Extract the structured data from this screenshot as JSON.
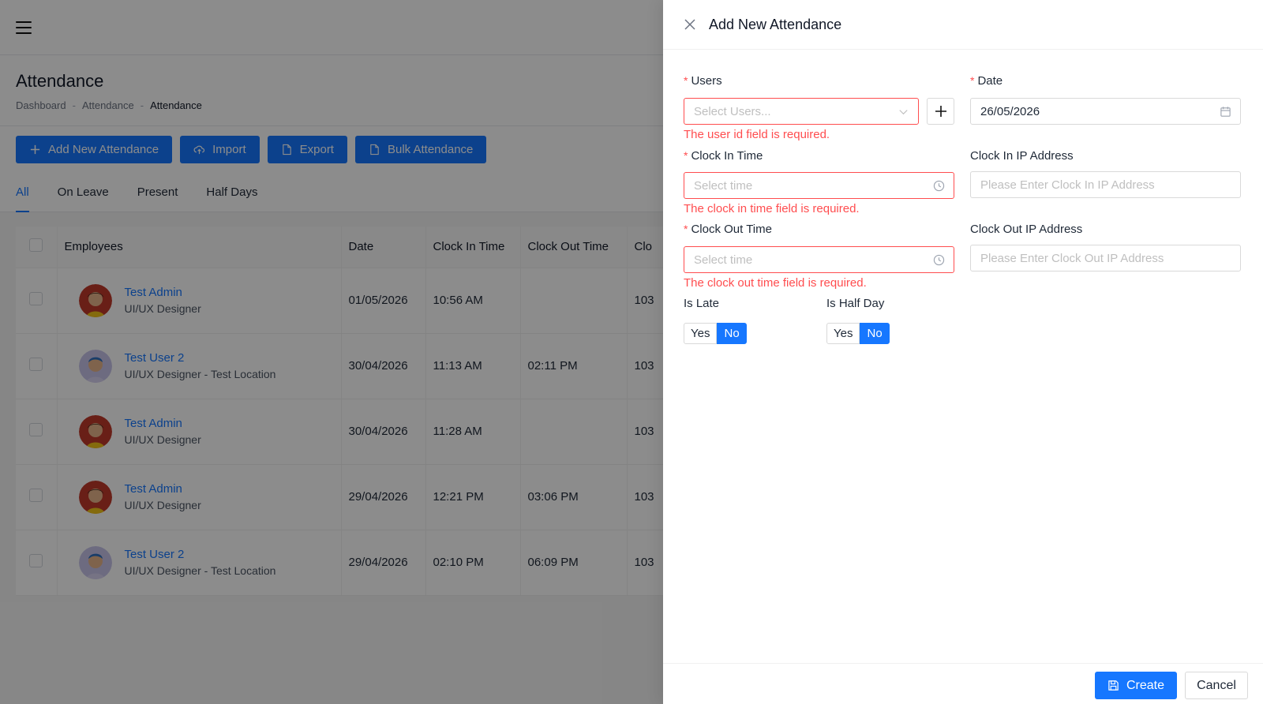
{
  "page": {
    "title": "Attendance",
    "breadcrumb": [
      "Dashboard",
      "-",
      "Attendance",
      "-",
      "Attendance"
    ]
  },
  "toolbar": {
    "add_label": "Add New Attendance",
    "import_label": "Import",
    "export_label": "Export",
    "bulk_label": "Bulk Attendance"
  },
  "tabs": [
    "All",
    "On Leave",
    "Present",
    "Half Days"
  ],
  "table": {
    "columns": [
      "Employees",
      "Date",
      "Clock In Time",
      "Clock Out Time",
      "Clo"
    ],
    "rows": [
      {
        "name": "Test Admin",
        "role": "UI/UX Designer",
        "date": "01/05/2026",
        "clock_in": "10:56 AM",
        "clock_out": "",
        "extra": "103"
      },
      {
        "name": "Test User 2",
        "role": "UI/UX Designer - Test Location",
        "date": "30/04/2026",
        "clock_in": "11:13 AM",
        "clock_out": "02:11 PM",
        "extra": "103"
      },
      {
        "name": "Test Admin",
        "role": "UI/UX Designer",
        "date": "30/04/2026",
        "clock_in": "11:28 AM",
        "clock_out": "",
        "extra": "103"
      },
      {
        "name": "Test Admin",
        "role": "UI/UX Designer",
        "date": "29/04/2026",
        "clock_in": "12:21 PM",
        "clock_out": "03:06 PM",
        "extra": "103"
      },
      {
        "name": "Test User 2",
        "role": "UI/UX Designer - Test Location",
        "date": "29/04/2026",
        "clock_in": "02:10 PM",
        "clock_out": "06:09 PM",
        "extra": "103"
      }
    ]
  },
  "drawer": {
    "title": "Add New Attendance",
    "users_label": "Users",
    "users_placeholder": "Select Users...",
    "users_error": "The user id field is required.",
    "date_label": "Date",
    "date_value": "26/05/2026",
    "clock_in_label": "Clock In Time",
    "clock_in_placeholder": "Select time",
    "clock_in_error": "The clock in time field is required.",
    "clock_in_ip_label": "Clock In IP Address",
    "clock_in_ip_placeholder": "Please Enter Clock In IP Address",
    "clock_out_label": "Clock Out Time",
    "clock_out_placeholder": "Select time",
    "clock_out_error": "The clock out time field is required.",
    "clock_out_ip_label": "Clock Out IP Address",
    "clock_out_ip_placeholder": "Please Enter Clock Out IP Address",
    "is_late_label": "Is Late",
    "is_half_day_label": "Is Half Day",
    "yes_label": "Yes",
    "no_label": "No",
    "create_label": "Create",
    "cancel_label": "Cancel"
  },
  "colors": {
    "primary": "#1677ff",
    "error": "#ff4d4f"
  }
}
